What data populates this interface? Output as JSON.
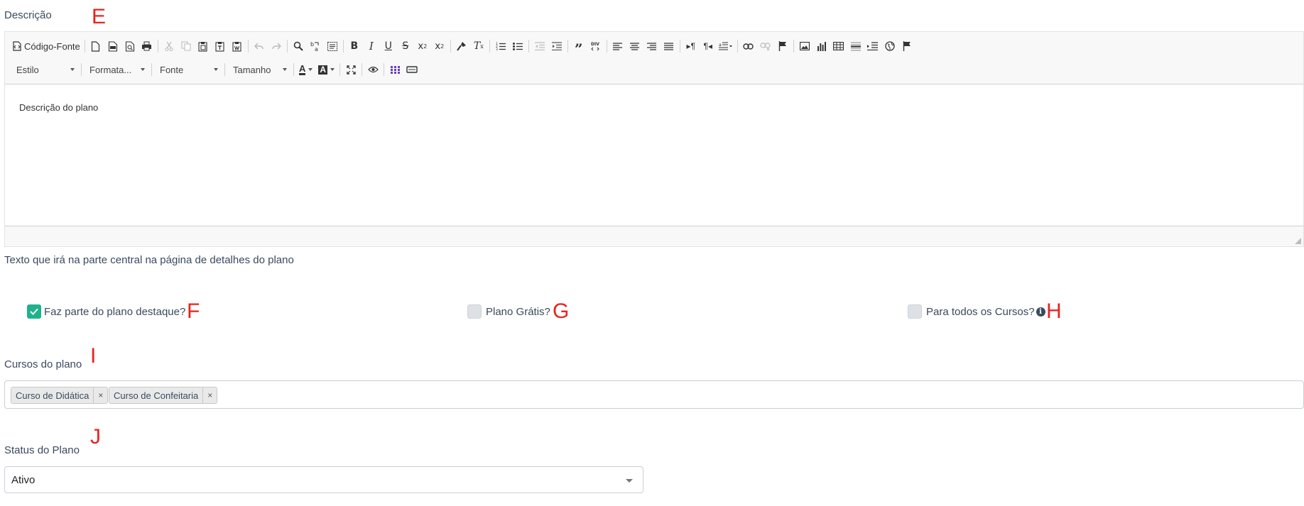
{
  "descricao": {
    "label": "Descrição",
    "marker": "E",
    "help_text": "Texto que irá na parte central na página de detalhes do plano"
  },
  "editor": {
    "source_button": "Código-Fonte",
    "toolbar_row1_icons": [
      "new-page-icon",
      "pdf-icon",
      "preview-icon",
      "print-icon",
      "cut-icon",
      "copy-icon",
      "paste-icon",
      "paste-text-icon",
      "paste-word-icon",
      "undo-icon",
      "redo-icon",
      "find-icon",
      "replace-icon",
      "select-all-icon",
      "bold-icon",
      "italic-icon",
      "underline-icon",
      "strike-icon",
      "subscript-icon",
      "superscript-icon",
      "copy-format-icon",
      "remove-format-icon",
      "numbered-list-icon",
      "bulleted-list-icon",
      "outdent-icon",
      "indent-icon",
      "blockquote-icon",
      "div-icon",
      "align-left-icon",
      "align-center-icon",
      "align-right-icon",
      "justify-icon",
      "ltr-icon",
      "rtl-icon",
      "language-icon",
      "link-icon",
      "unlink-icon",
      "anchor-icon",
      "image-icon",
      "chart-icon",
      "table-icon",
      "horizontal-line-icon",
      "page-break-icon",
      "iframe-icon",
      "flag-icon"
    ],
    "style_combo": "Estilo",
    "format_combo": "Formata...",
    "font_combo": "Fonte",
    "size_combo": "Tamanho",
    "text_color_glyph": "A",
    "bg_color_glyph": "A",
    "content": "Descrição do plano"
  },
  "checkboxes": {
    "destaque": {
      "label": "Faz parte do plano destaque?",
      "checked": true,
      "marker": "F"
    },
    "gratis": {
      "label": "Plano Grátis?",
      "checked": false,
      "marker": "G"
    },
    "todos_cursos": {
      "label": "Para todos os Cursos?",
      "checked": false,
      "marker": "H",
      "info": "i"
    }
  },
  "cursos": {
    "label": "Cursos do plano",
    "marker": "I",
    "chips": [
      "Curso de Didática",
      "Curso de Confeitaria"
    ],
    "remove_glyph": "×"
  },
  "status": {
    "label": "Status do Plano",
    "marker": "J",
    "value": "Ativo"
  },
  "colors": {
    "accent_green": "#1fb28d",
    "marker_red": "#e8231f",
    "label_text": "#3a4a5e"
  }
}
